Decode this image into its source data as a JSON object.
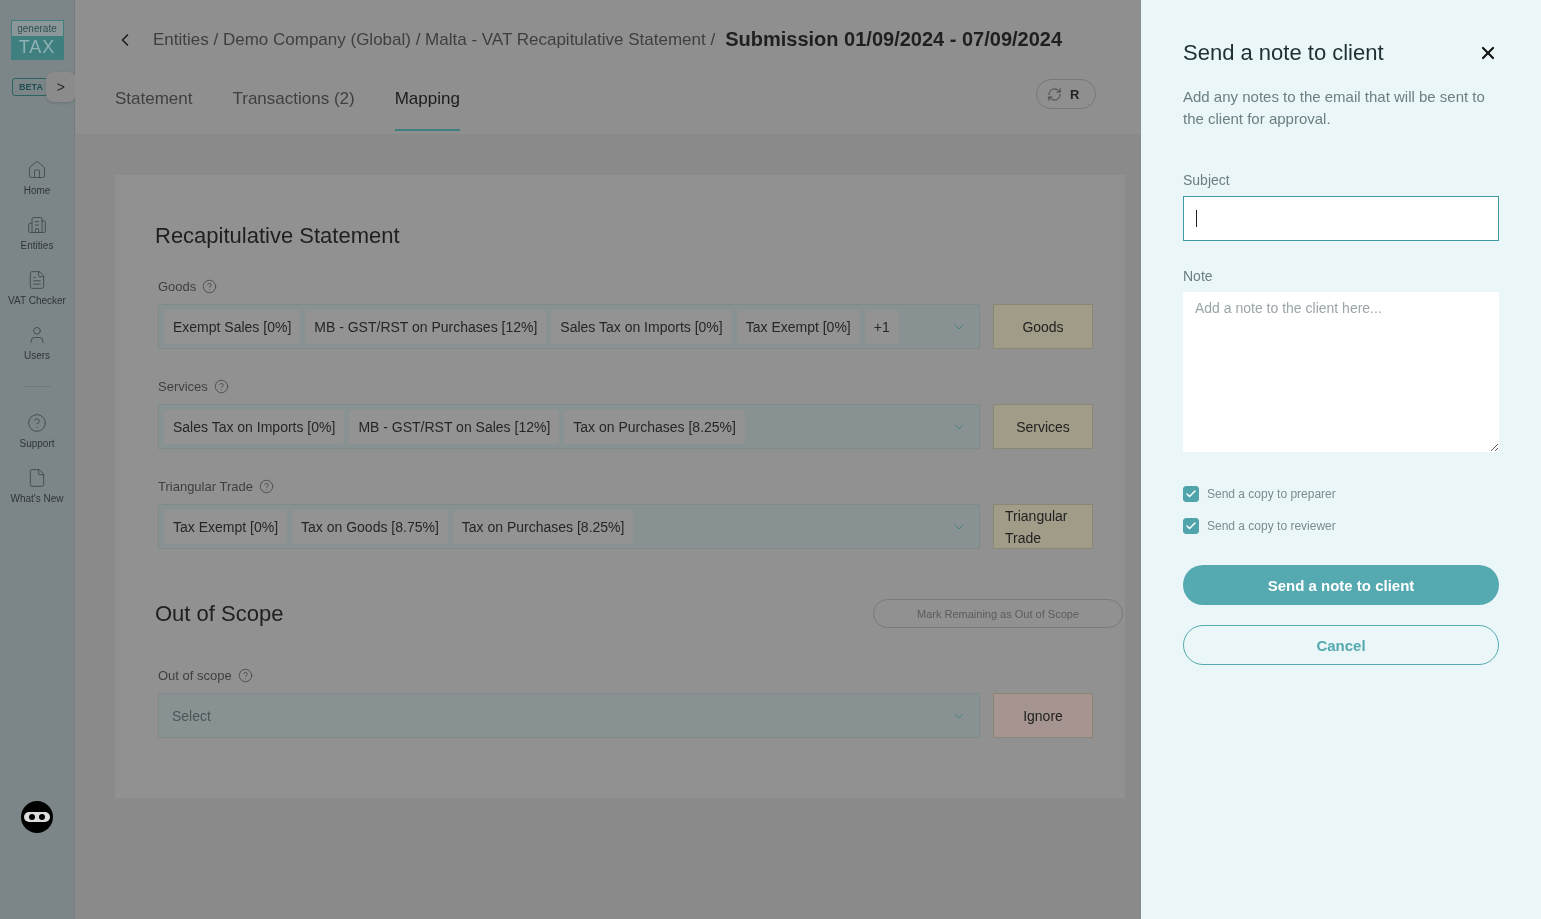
{
  "sidebar": {
    "logo": {
      "top": "generate",
      "bottom": "TAX"
    },
    "badge": "BETA",
    "expand_icon": ">",
    "items": [
      {
        "label": "Home"
      },
      {
        "label": "Entities"
      },
      {
        "label": "VAT Checker"
      },
      {
        "label": "Users"
      }
    ],
    "footer_items": [
      {
        "label": "Support"
      },
      {
        "label": "What's New"
      }
    ]
  },
  "header": {
    "breadcrumb": "Entities / Demo Company (Global) / Malta - VAT Recapitulative Statement /",
    "title": "Submission 01/09/2024 - 07/09/2024",
    "action_label": "R",
    "tabs": [
      {
        "label": "Statement",
        "selected": false
      },
      {
        "label": "Transactions (2)",
        "selected": false
      },
      {
        "label": "Mapping",
        "selected": true
      }
    ]
  },
  "statement": {
    "title": "Recapitulative Statement",
    "groups": [
      {
        "label": "Goods",
        "chips": [
          "Exempt Sales [0%]",
          "MB - GST/RST on Purchases [12%]",
          "Sales Tax on Imports [0%]",
          "Tax Exempt [0%]"
        ],
        "more": "+1",
        "button": {
          "label": "Goods",
          "kind": "category"
        }
      },
      {
        "label": "Services",
        "chips": [
          "Sales Tax on Imports [0%]",
          "MB - GST/RST on Sales [12%]",
          "Tax on Purchases [8.25%]"
        ],
        "button": {
          "label": "Services",
          "kind": "category"
        }
      },
      {
        "label": "Triangular Trade",
        "chips": [
          "Tax Exempt [0%]",
          "Tax on Goods [8.75%]",
          "Tax on Purchases [8.25%]"
        ],
        "button": {
          "label": "Triangular Trade",
          "kind": "category"
        }
      }
    ]
  },
  "out_of_scope": {
    "title": "Out of Scope",
    "action": {
      "label": "Mark Remaining as Out of Scope",
      "disabled": true
    },
    "groups": [
      {
        "label": "Out of scope",
        "placeholder": "Select",
        "button": {
          "label": "Ignore",
          "kind": "ignore"
        }
      }
    ]
  },
  "drawer": {
    "title": "Send a note to client",
    "description": "Add any notes to the email that will be sent to the client for approval.",
    "subject": {
      "label": "Subject",
      "focused": true
    },
    "note": {
      "label": "Note",
      "placeholder": "Add a note to the client here..."
    },
    "checkboxes": [
      {
        "label": "Send a copy to preparer",
        "checked": true
      },
      {
        "label": "Send a copy to reviewer",
        "checked": true
      }
    ],
    "primary": "Send a note to client",
    "secondary": "Cancel"
  }
}
